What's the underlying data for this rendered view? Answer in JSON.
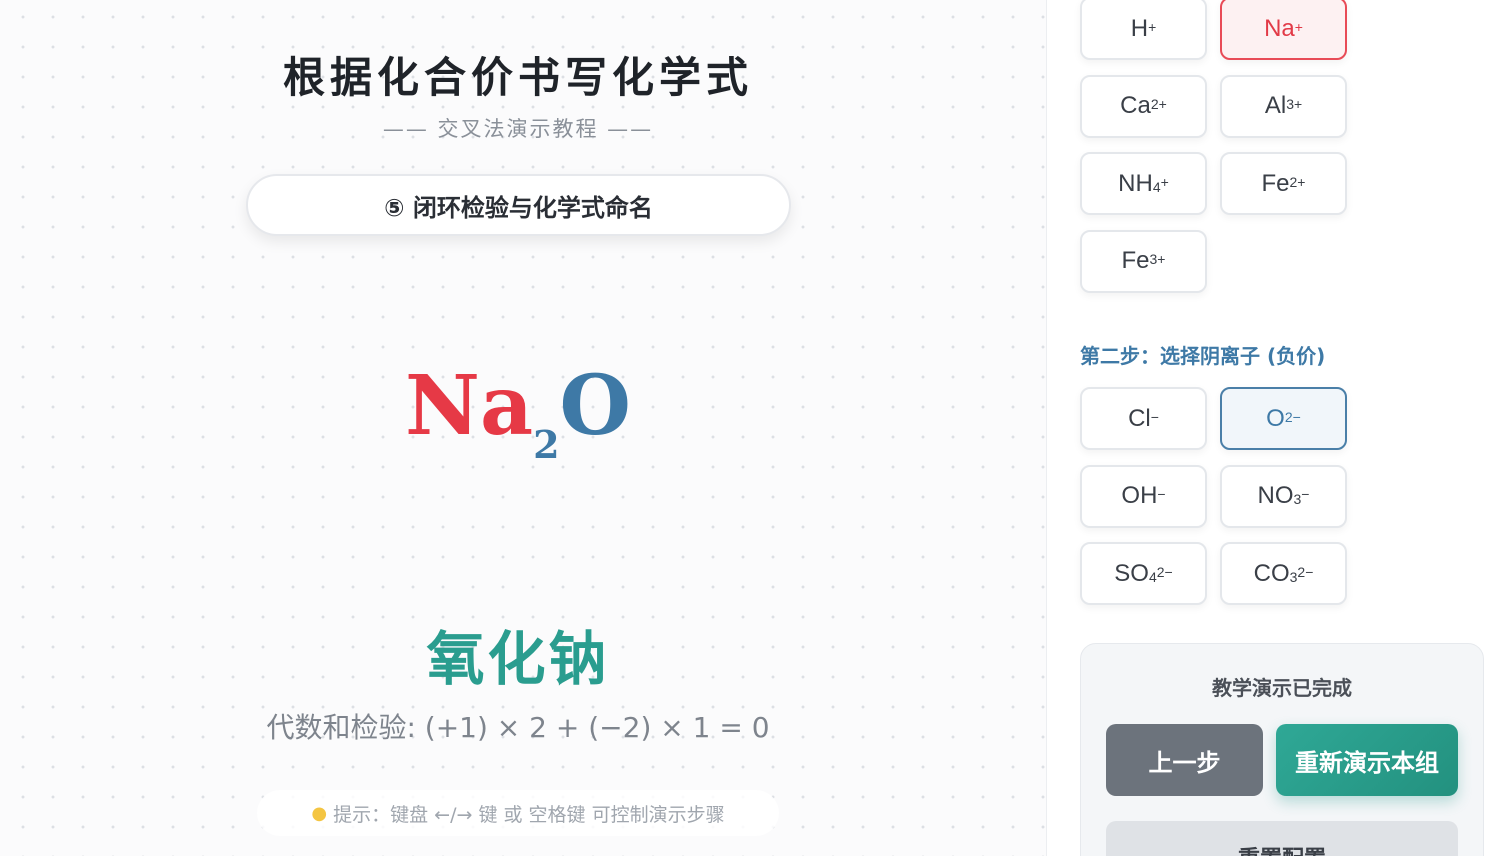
{
  "stage": {
    "title": "根据化合价书写化学式",
    "subtitle": "—— 交叉法演示教程 ——",
    "step_label": "⑤ 闭环检验与化学式命名",
    "formula": {
      "cation_symbol": "Na",
      "cation_subscript": "2",
      "anion_symbol": "O"
    },
    "compound_name": "氧化钠",
    "check": "代数和检验: (+1) × 2 + (−2) × 1 = 0",
    "hint_icon": "lightbulb-icon",
    "hint": "提示：键盘 ←/→ 键 或 空格键 可控制演示步骤"
  },
  "panel": {
    "cations": [
      {
        "symbol": "H",
        "charge": "+",
        "sub": "",
        "selected": false
      },
      {
        "symbol": "Na",
        "charge": "+",
        "sub": "",
        "selected": true
      },
      {
        "symbol": "Ca",
        "charge": "2+",
        "sub": "",
        "selected": false
      },
      {
        "symbol": "Al",
        "charge": "3+",
        "sub": "",
        "selected": false
      },
      {
        "symbol": "NH",
        "charge": "+",
        "sub": "4",
        "selected": false
      },
      {
        "symbol": "Fe",
        "charge": "2+",
        "sub": "",
        "selected": false
      },
      {
        "symbol": "Fe",
        "charge": "3+",
        "sub": "",
        "selected": false
      }
    ],
    "anion_section_label": "第二步：选择阴离子 (负价)",
    "anions": [
      {
        "symbol": "Cl",
        "charge": "−",
        "sub": "",
        "selected": false
      },
      {
        "symbol": "O",
        "charge": "2−",
        "sub": "",
        "selected": true
      },
      {
        "symbol": "OH",
        "charge": "−",
        "sub": "",
        "selected": false
      },
      {
        "symbol": "NO",
        "charge": "−",
        "sub": "3",
        "selected": false
      },
      {
        "symbol": "SO",
        "charge": "2−",
        "sub": "4",
        "selected": false
      },
      {
        "symbol": "CO",
        "charge": "2−",
        "sub": "3",
        "selected": false
      }
    ],
    "status": "教学演示已完成",
    "prev_label": "上一步",
    "replay_label": "重新演示本组",
    "reset_label": "重置配置"
  },
  "colors": {
    "cation": "#e63946",
    "anion": "#3e79a6",
    "name": "#2a9d8f"
  }
}
